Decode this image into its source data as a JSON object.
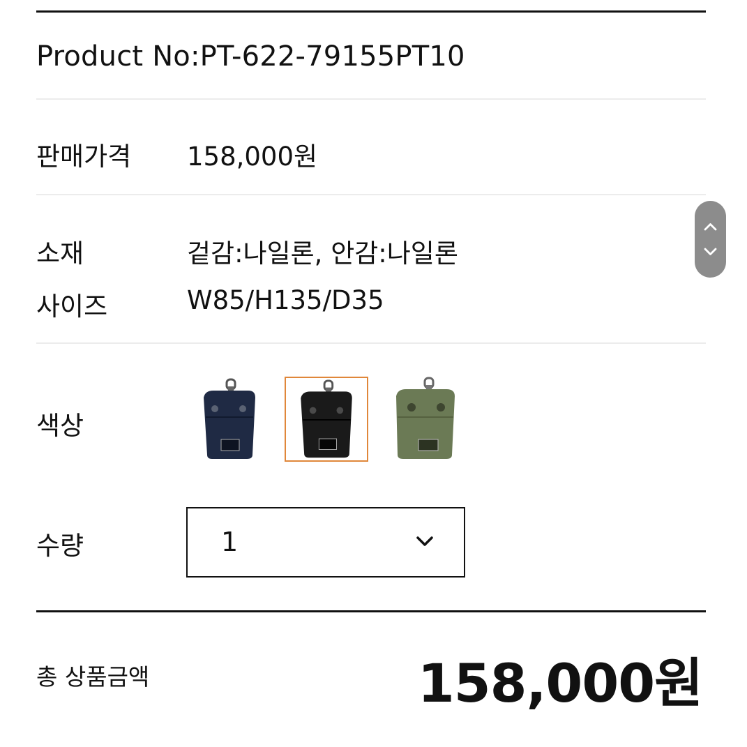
{
  "product": {
    "number_text": "Product No:PT-622-79155PT10"
  },
  "rows": {
    "price_label": "판매가격",
    "price_value": "158,000원",
    "material_label": "소재",
    "material_value": "겉감:나일론, 안감:나일론",
    "size_label": "사이즈",
    "size_value": "W85/H135/D35",
    "color_label": "색상",
    "quantity_label": "수량"
  },
  "colors": {
    "swatches": [
      {
        "name": "navy-bag",
        "body_color": "#1f2a44",
        "selected": false
      },
      {
        "name": "black-bag",
        "body_color": "#1a1a1a",
        "selected": true
      },
      {
        "name": "olive-bag",
        "body_color": "#6b7a55",
        "selected": false
      }
    ],
    "selected_border": "#e0873a"
  },
  "quantity": {
    "selected_value": "1"
  },
  "total": {
    "label": "총 상품금액",
    "amount": "158,000원"
  }
}
